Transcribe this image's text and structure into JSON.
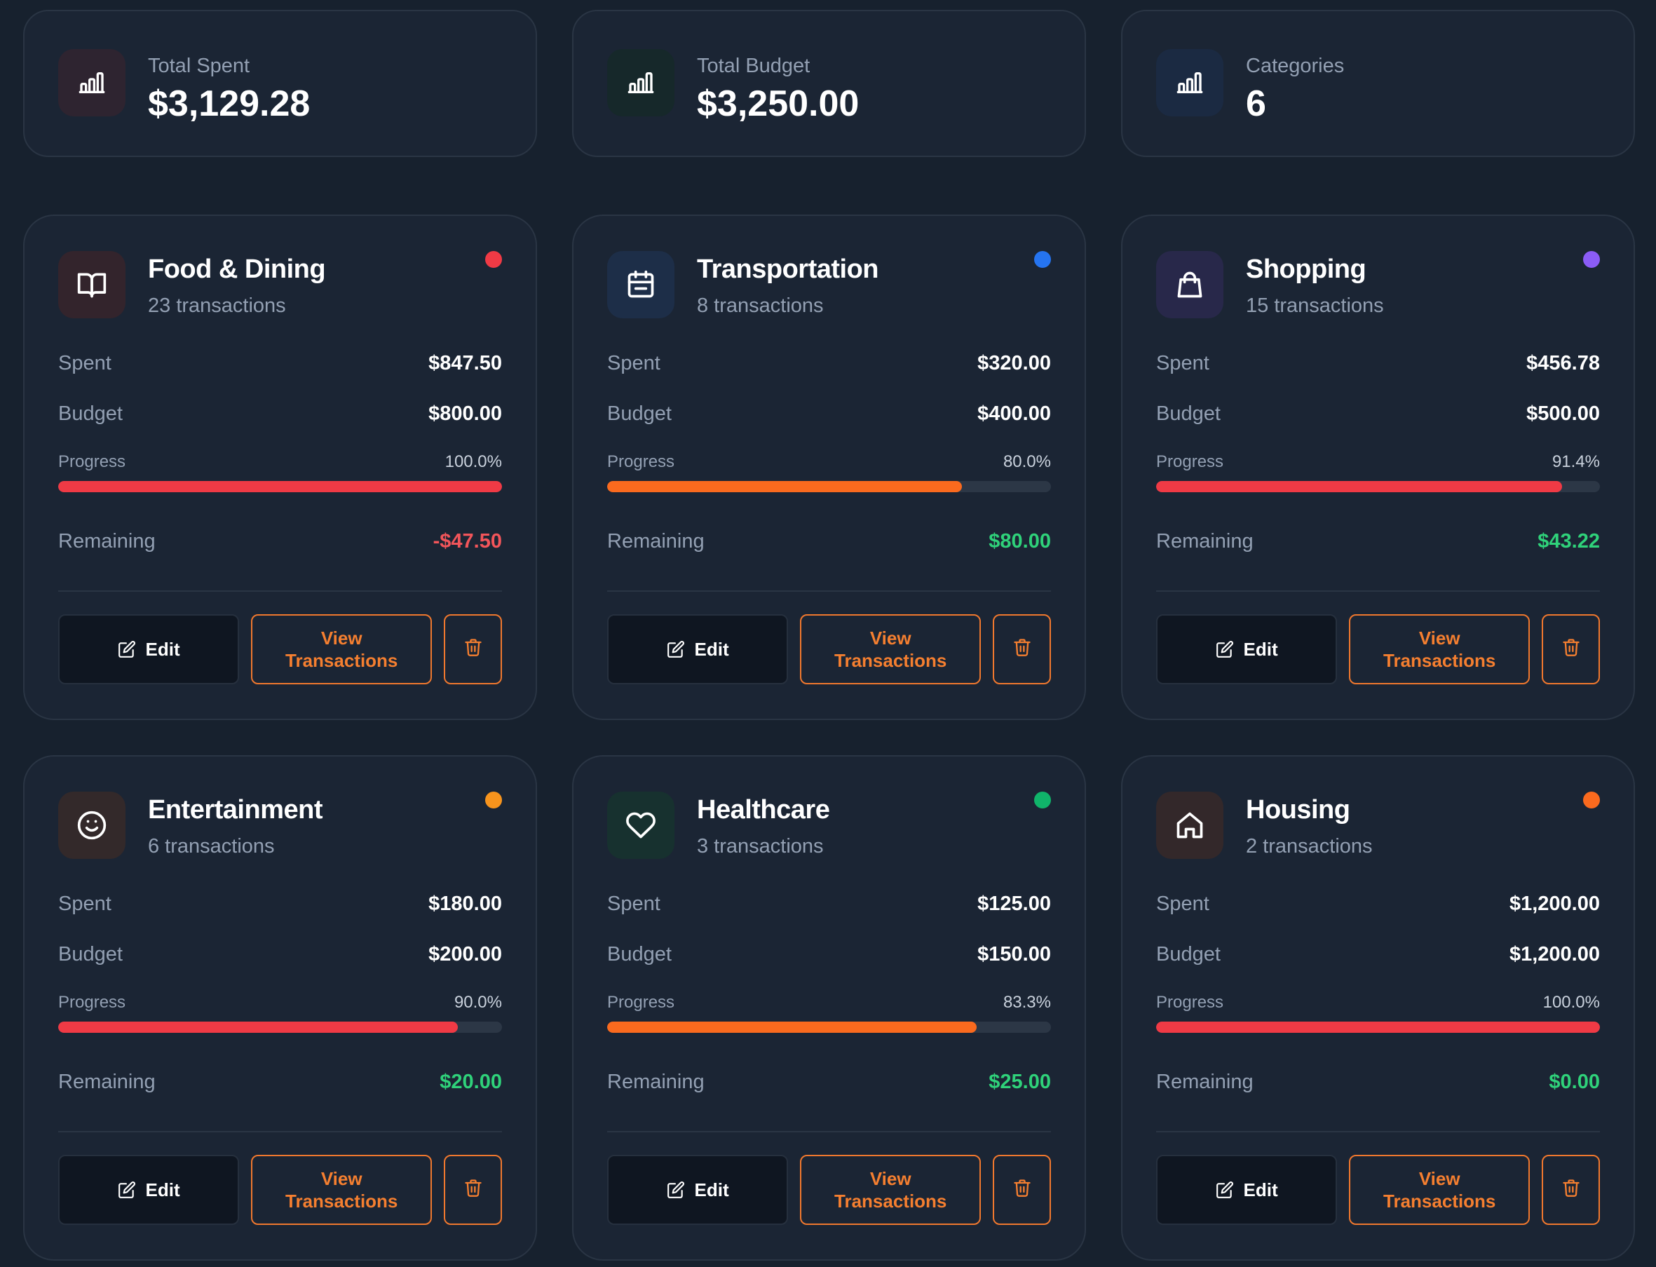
{
  "summary": [
    {
      "label": "Total Spent",
      "value": "$3,129.28",
      "icon": "bar-chart-icon",
      "icon_bg": "#2e2430"
    },
    {
      "label": "Total Budget",
      "value": "$3,250.00",
      "icon": "bar-chart-icon",
      "icon_bg": "#16282a"
    },
    {
      "label": "Categories",
      "value": "6",
      "icon": "bar-chart-icon",
      "icon_bg": "#1b2a42"
    }
  ],
  "labels": {
    "spent": "Spent",
    "budget": "Budget",
    "progress": "Progress",
    "remaining": "Remaining",
    "edit": "Edit",
    "view_line1": "View",
    "view_line2": "Transactions"
  },
  "categories": [
    {
      "name": "Food & Dining",
      "count": "23 transactions",
      "spent": "$847.50",
      "budget": "$800.00",
      "progress_text": "100.0%",
      "progress": 1.0,
      "remaining": "-$47.50",
      "remaining_color": "#f2555a",
      "bar_color": "#f03a45",
      "dot_color": "#f03a45",
      "icon": "book-icon",
      "icon_bg": "#33242c"
    },
    {
      "name": "Transportation",
      "count": "8 transactions",
      "spent": "$320.00",
      "budget": "$400.00",
      "progress_text": "80.0%",
      "progress": 0.8,
      "remaining": "$80.00",
      "remaining_color": "#2fd27a",
      "bar_color": "#fa6a1e",
      "dot_color": "#2574f0",
      "icon": "calendar-icon",
      "icon_bg": "#1d2e48"
    },
    {
      "name": "Shopping",
      "count": "15 transactions",
      "spent": "$456.78",
      "budget": "$500.00",
      "progress_text": "91.4%",
      "progress": 0.914,
      "remaining": "$43.22",
      "remaining_color": "#2fd27a",
      "bar_color": "#f03a45",
      "dot_color": "#8b5cf6",
      "icon": "shopping-bag-icon",
      "icon_bg": "#28284a"
    },
    {
      "name": "Entertainment",
      "count": "6 transactions",
      "spent": "$180.00",
      "budget": "$200.00",
      "progress_text": "90.0%",
      "progress": 0.9,
      "remaining": "$20.00",
      "remaining_color": "#2fd27a",
      "bar_color": "#f03a45",
      "dot_color": "#f7941d",
      "icon": "smile-icon",
      "icon_bg": "#33292a"
    },
    {
      "name": "Healthcare",
      "count": "3 transactions",
      "spent": "$125.00",
      "budget": "$150.00",
      "progress_text": "83.3%",
      "progress": 0.833,
      "remaining": "$25.00",
      "remaining_color": "#2fd27a",
      "bar_color": "#fa6a1e",
      "dot_color": "#10b46a",
      "icon": "heart-icon",
      "icon_bg": "#17312f"
    },
    {
      "name": "Housing",
      "count": "2 transactions",
      "spent": "$1,200.00",
      "budget": "$1,200.00",
      "progress_text": "100.0%",
      "progress": 1.0,
      "remaining": "$0.00",
      "remaining_color": "#2fd27a",
      "bar_color": "#f03a45",
      "dot_color": "#fa6a1e",
      "icon": "house-icon",
      "icon_bg": "#33282a"
    }
  ]
}
